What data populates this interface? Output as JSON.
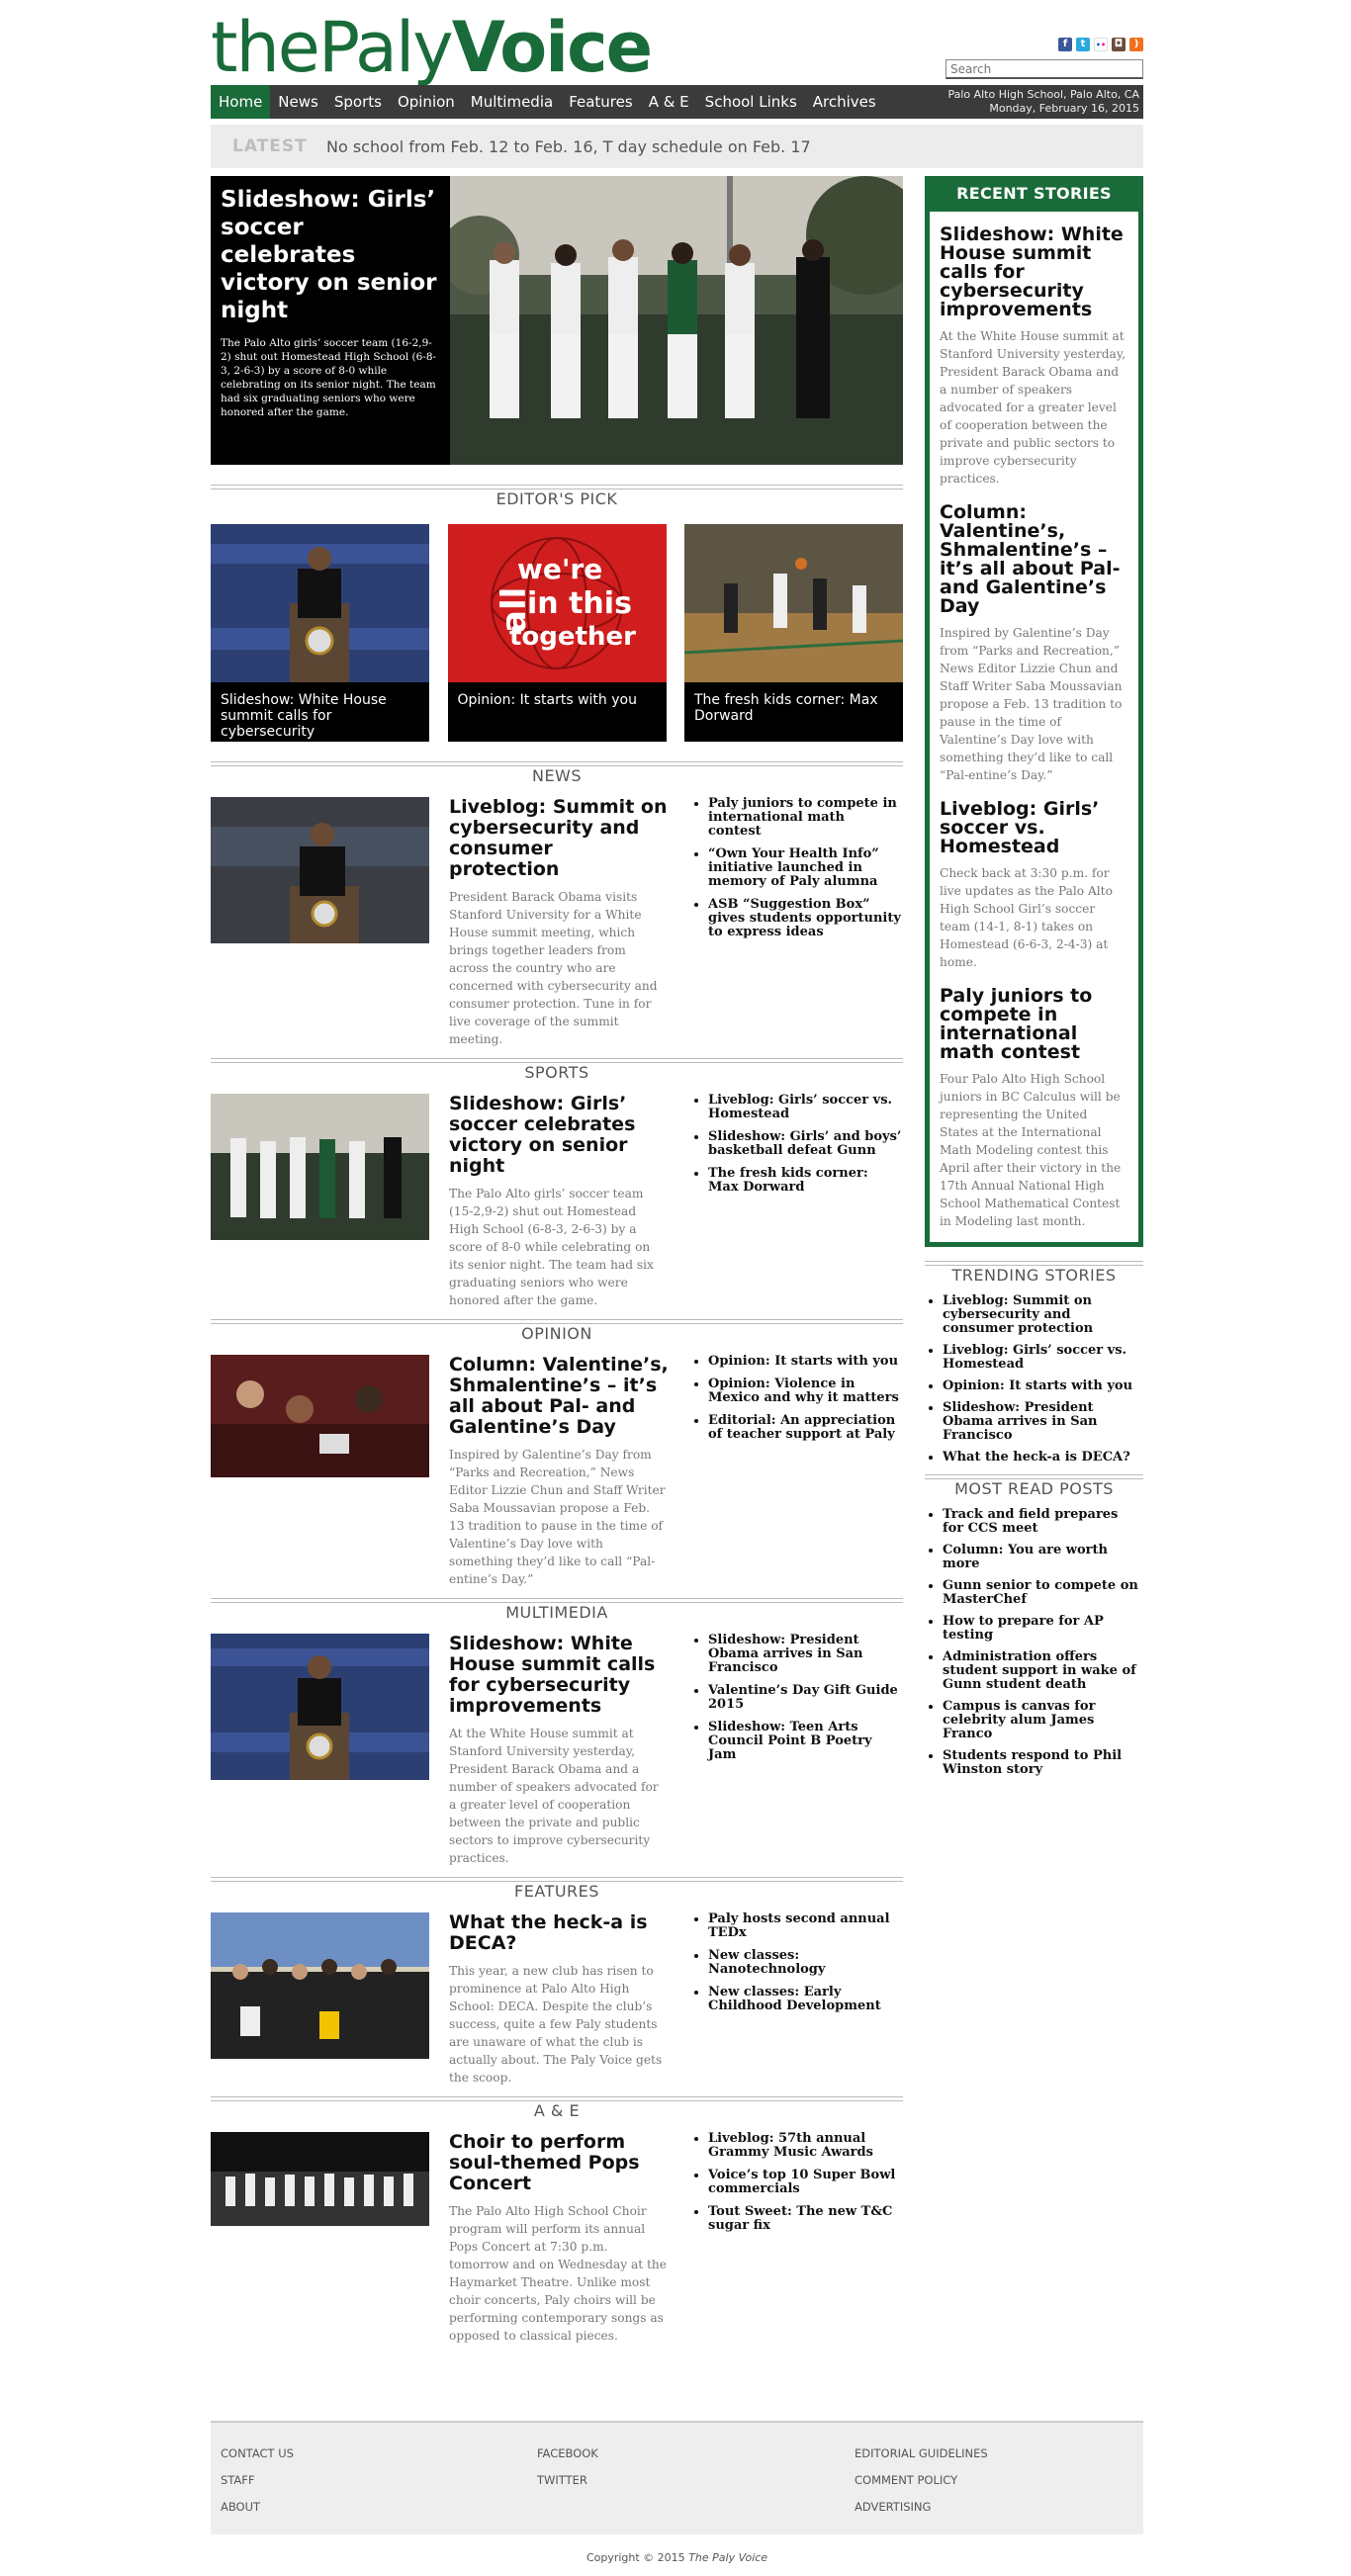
{
  "brand": {
    "the": "the",
    "paly": "Paly",
    "voice": "Voice"
  },
  "social": [
    {
      "icon": "facebook-icon",
      "glyph": "f",
      "color": "#3b5998"
    },
    {
      "icon": "twitter-icon",
      "glyph": "t",
      "color": "#2aa9e0"
    },
    {
      "icon": "flickr-icon",
      "glyph": "••",
      "color": "#ffffff"
    },
    {
      "icon": "instagram-icon",
      "glyph": "◘",
      "color": "#6b4d3b"
    },
    {
      "icon": "rss-icon",
      "glyph": ")",
      "color": "#f37021"
    }
  ],
  "search": {
    "placeholder": "Search"
  },
  "nav": {
    "items": [
      "Home",
      "News",
      "Sports",
      "Opinion",
      "Multimedia",
      "Features",
      "A & E",
      "School Links",
      "Archives"
    ],
    "location": "Palo Alto High School, Palo Alto, CA",
    "date": "Monday, February 16, 2015"
  },
  "latest": {
    "label": "LATEST",
    "text": "No school from Feb. 12 to Feb. 16, T day schedule on Feb. 17"
  },
  "hero": {
    "title": "Slideshow: Girls’ soccer celebrates victory on senior night",
    "summary": "The Palo Alto girls’ soccer team (16-2,9-2) shut out Homestead High School (6-8-3, 2-6-3) by a score of 8-0 while celebrating on its senior night. The team had six graduating seniors who were honored after the game."
  },
  "editors_pick": {
    "heading": "EDITOR'S PICK",
    "items": [
      {
        "caption": "Slideshow: White House summit calls for cybersecurity"
      },
      {
        "caption": "Opinion: It starts with you",
        "img_text": [
          "we're",
          "all",
          "in this",
          "together"
        ]
      },
      {
        "caption": "The fresh kids corner: Max Dorward"
      }
    ]
  },
  "sections": [
    {
      "heading": "NEWS",
      "title": "Liveblog: Summit on cybersecurity and consumer protection",
      "summary": "President Barack Obama visits Stanford University for a White House summit meeting, which brings together leaders from across the country who are concerned with cybersecurity and consumer protection. Tune in for live coverage of the summit meeting.",
      "links": [
        "Paly juniors to compete in international math contest",
        "“Own Your Health Info” initiative launched in memory of Paly alumna",
        "ASB “Suggestion Box” gives students opportunity to express ideas"
      ]
    },
    {
      "heading": "SPORTS",
      "title": "Slideshow: Girls’ soccer celebrates victory on senior night",
      "summary": "The Palo Alto girls’ soccer team (15-2,9-2) shut out Homestead High School (6-8-3, 2-6-3) by a score of 8-0 while celebrating on its senior night. The team had six graduating seniors who were honored after the game.",
      "links": [
        "Liveblog: Girls’ soccer vs. Homestead",
        "Slideshow: Girls’ and boys’ basketball defeat Gunn",
        "The fresh kids corner: Max Dorward"
      ]
    },
    {
      "heading": "OPINION",
      "title": "Column: Valentine’s, Shmalentine’s – it’s all about Pal- and Galentine’s Day",
      "summary": "Inspired by Galentine’s Day from “Parks and Recreation,” News Editor Lizzie Chun and Staff Writer Saba Moussavian propose a Feb. 13 tradition to pause in the time of Valentine’s Day love with something they’d like to call “Pal-entine’s Day.”",
      "links": [
        "Opinion: It starts with you",
        "Opinion: Violence in Mexico and why it matters",
        "Editorial: An appreciation of teacher support at Paly"
      ]
    },
    {
      "heading": "MULTIMEDIA",
      "title": "Slideshow: White House summit calls for cybersecurity improvements",
      "summary": "At the White House summit at Stanford University yesterday, President Barack Obama and a number of speakers advocated for a greater level of cooperation between the private and public sectors to improve cybersecurity practices.",
      "links": [
        "Slideshow: President Obama arrives in San Francisco",
        "Valentine’s Day Gift Guide 2015",
        "Slideshow: Teen Arts Council Point B Poetry Jam"
      ]
    },
    {
      "heading": "FEATURES",
      "title": "What the heck-a is DECA?",
      "summary": "This year, a new club has risen to prominence at Palo Alto High School: DECA. Despite the club’s success, quite a few Paly students are unaware of what the club is actually about. The Paly Voice gets the scoop.",
      "links": [
        "Paly hosts second annual TEDx",
        "New classes: Nanotechnology",
        "New classes: Early Childhood Development"
      ]
    },
    {
      "heading": "A & E",
      "title": "Choir to perform soul-themed Pops Concert",
      "summary": "The Palo Alto High School Choir program will perform its annual Pops Concert at 7:30 p.m. tomorrow and on Wednesday at the Haymarket Theatre. Unlike most choir concerts, Paly choirs will be performing contemporary songs as opposed to classical pieces.",
      "links": [
        "Liveblog: 57th annual Grammy Music Awards",
        "Voice’s top 10 Super Bowl commercials",
        "Tout Sweet: The new T&C sugar fix"
      ]
    }
  ],
  "recent": {
    "heading": "RECENT STORIES",
    "items": [
      {
        "title": "Slideshow: White House summit calls for cybersecurity improvements",
        "summary": "At the White House summit at Stanford University yesterday, President Barack Obama and a number of speakers advocated for a greater level of cooperation between the private and public sectors to improve cybersecurity practices."
      },
      {
        "title": "Column: Valentine’s, Shmalentine’s – it’s all about Pal- and Galentine’s Day",
        "summary": "Inspired by Galentine’s Day from “Parks and Recreation,” News Editor Lizzie Chun and Staff Writer Saba Moussavian propose a Feb. 13 tradition to pause in the time of Valentine’s Day love with something they’d like to call “Pal-entine’s Day.”"
      },
      {
        "title": "Liveblog: Girls’ soccer vs. Homestead",
        "summary": "Check back at 3:30 p.m. for live updates as the Palo Alto High School Girl’s soccer team (14-1, 8-1) takes on Homestead (6-6-3, 2-4-3) at home."
      },
      {
        "title": "Paly juniors to compete in international math contest",
        "summary": "Four Palo Alto High School juniors in BC Calculus will be representing the United States at the International Math Modeling contest this April after their victory in the 17th Annual National High School Mathematical Contest in Modeling last month."
      }
    ]
  },
  "trending": {
    "heading": "TRENDING STORIES",
    "items": [
      "Liveblog: Summit on cybersecurity and consumer protection",
      "Liveblog: Girls’ soccer vs. Homestead",
      "Opinion: It starts with you",
      "Slideshow: President Obama arrives in San Francisco",
      "What the heck-a is DECA?"
    ]
  },
  "most_read": {
    "heading": "MOST READ POSTS",
    "items": [
      "Track and field prepares for CCS meet",
      "Column: You are worth more",
      "Gunn senior to compete on MasterChef",
      "How to prepare for AP testing",
      "Administration offers student support in wake of Gunn student death",
      "Campus is canvas for celebrity alum James Franco",
      "Students respond to Phil Winston story"
    ]
  },
  "footer": {
    "col1": [
      "CONTACT US",
      "STAFF",
      "ABOUT"
    ],
    "col2": [
      "FACEBOOK",
      "TWITTER"
    ],
    "col3": [
      "EDITORIAL GUIDELINES",
      "COMMENT POLICY",
      "ADVERTISING"
    ],
    "copyright_prefix": "Copyright © 2015",
    "copyright_name": "The Paly Voice"
  },
  "colors": {
    "brand_green": "#1a6b3a",
    "nav_dark": "#3b3b3b",
    "latest_bg": "#ececec"
  }
}
